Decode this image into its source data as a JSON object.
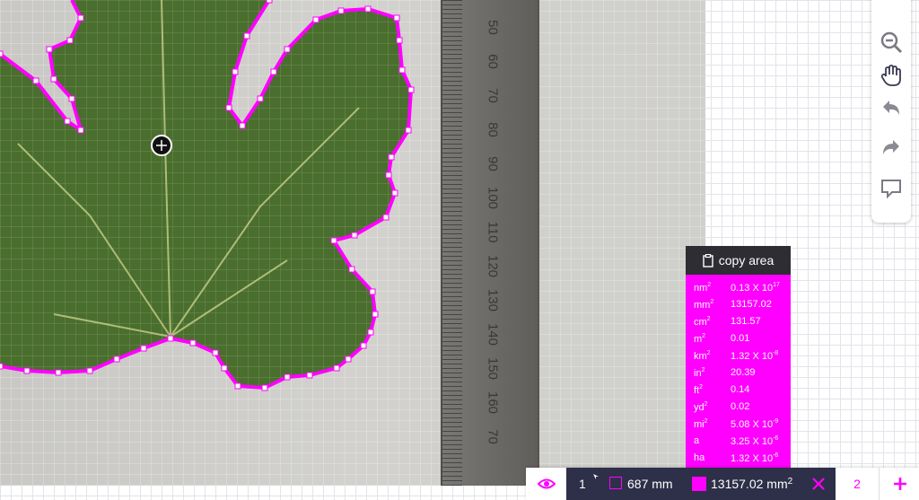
{
  "ruler": {
    "labels": [
      "50",
      "60",
      "70",
      "80",
      "90",
      "100",
      "110",
      "120",
      "130",
      "140",
      "150",
      "160",
      "70"
    ]
  },
  "toolbar": {
    "tools": [
      "zoom-out-icon",
      "hand-pan-icon",
      "undo-icon",
      "redo-icon",
      "comment-icon"
    ]
  },
  "panel": {
    "copy_label": "copy area",
    "rows": [
      {
        "unit": "nm",
        "exp": "2",
        "value": "0.13 X 10",
        "value_exp": "17"
      },
      {
        "unit": "mm",
        "exp": "2",
        "value": "13157.02",
        "value_exp": ""
      },
      {
        "unit": "cm",
        "exp": "2",
        "value": "131.57",
        "value_exp": ""
      },
      {
        "unit": "m",
        "exp": "2",
        "value": "0.01",
        "value_exp": ""
      },
      {
        "unit": "km",
        "exp": "2",
        "value": "1.32 X 10",
        "value_exp": "-8"
      },
      {
        "unit": "in",
        "exp": "2",
        "value": "20.39",
        "value_exp": ""
      },
      {
        "unit": "ft",
        "exp": "2",
        "value": "0.14",
        "value_exp": ""
      },
      {
        "unit": "yd",
        "exp": "2",
        "value": "0.02",
        "value_exp": ""
      },
      {
        "unit": "mi",
        "exp": "2",
        "value": "5.08 X 10",
        "value_exp": "-9"
      },
      {
        "unit": "a",
        "exp": "",
        "value": "3.25 X 10",
        "value_exp": "-6"
      },
      {
        "unit": "ha",
        "exp": "",
        "value": "1.32 X 10",
        "value_exp": "-6"
      }
    ]
  },
  "bottom": {
    "layer_number": "1",
    "perimeter": "687 mm",
    "area": "13157.02 mm",
    "area_exp": "2",
    "next_number": "2"
  },
  "colors": {
    "accent": "#ff00ff",
    "dark": "#2e3049",
    "panel_head": "#2d2d33"
  }
}
